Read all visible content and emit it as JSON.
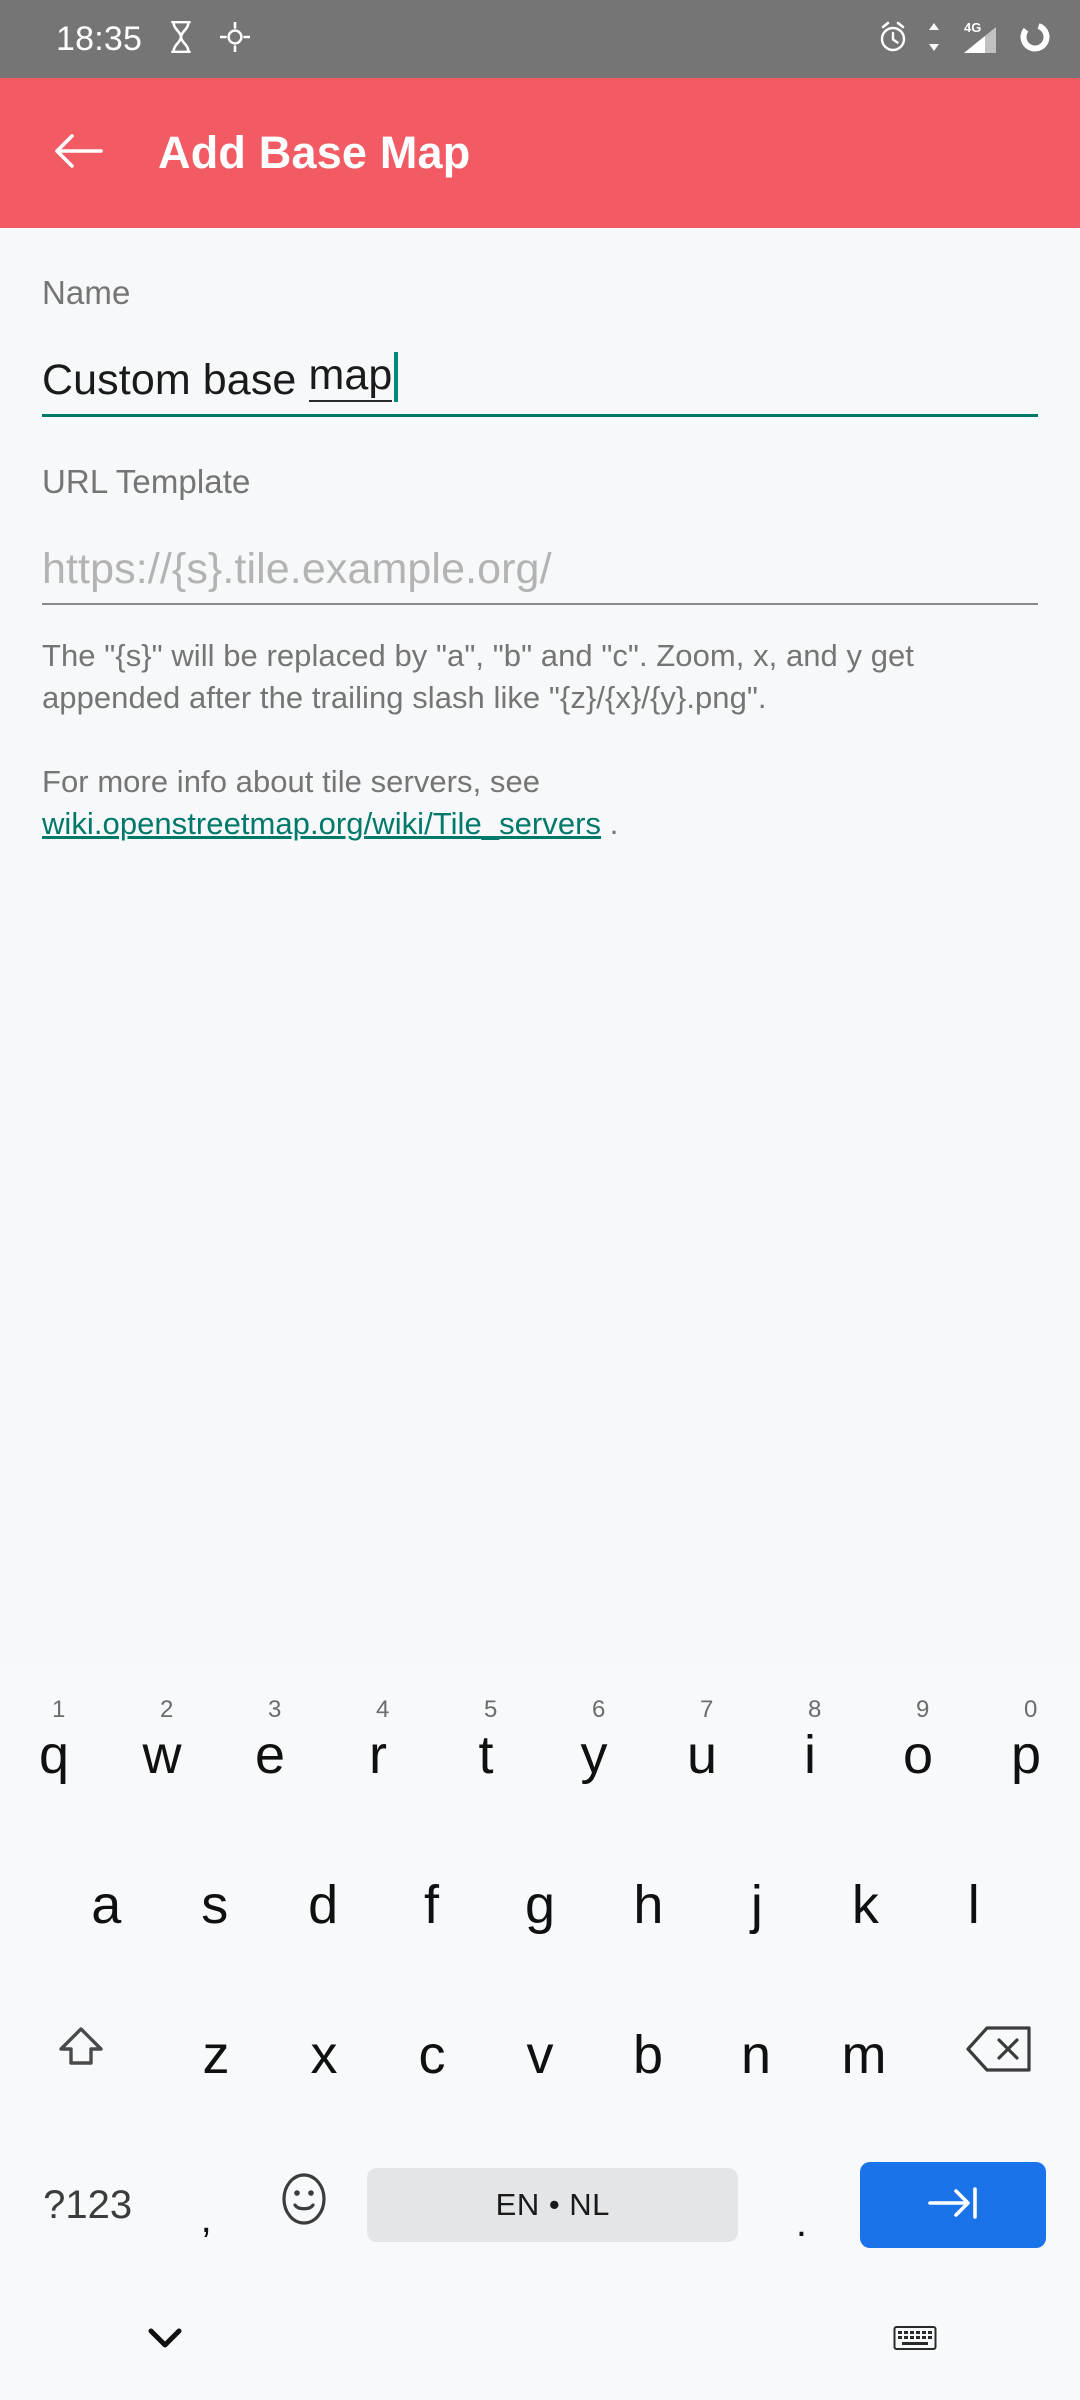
{
  "status_bar": {
    "time": "18:35",
    "network_label": "4G",
    "icons": [
      "hourglass-icon",
      "gps-crosshair-icon",
      "alarm-clock-icon",
      "data-transfer-icon",
      "signal-bars-icon",
      "battery-ring-icon"
    ]
  },
  "app_bar": {
    "title": "Add Base Map",
    "back_icon": "arrow-left-icon"
  },
  "form": {
    "name_field": {
      "label": "Name",
      "value_plain": "Custom base ",
      "value_composing": "map"
    },
    "url_field": {
      "label": "URL Template",
      "value": "",
      "placeholder": "https://{s}.tile.example.org/"
    },
    "helper_1": "The \"{s}\" will be replaced by \"a\", \"b\" and \"c\". Zoom, x, and y get appended after the trailing slash like \"{z}/{x}/{y}.png\".",
    "helper_2_prefix": "For more info about tile servers, see ",
    "helper_2_link": "wiki.openstreetmap.org/wiki/Tile_servers",
    "helper_2_suffix": " ."
  },
  "keyboard": {
    "row1": [
      {
        "key": "q",
        "hint": "1"
      },
      {
        "key": "w",
        "hint": "2"
      },
      {
        "key": "e",
        "hint": "3"
      },
      {
        "key": "r",
        "hint": "4"
      },
      {
        "key": "t",
        "hint": "5"
      },
      {
        "key": "y",
        "hint": "6"
      },
      {
        "key": "u",
        "hint": "7"
      },
      {
        "key": "i",
        "hint": "8"
      },
      {
        "key": "o",
        "hint": "9"
      },
      {
        "key": "p",
        "hint": "0"
      }
    ],
    "row2": [
      {
        "key": "a"
      },
      {
        "key": "s"
      },
      {
        "key": "d"
      },
      {
        "key": "f"
      },
      {
        "key": "g"
      },
      {
        "key": "h"
      },
      {
        "key": "j"
      },
      {
        "key": "k"
      },
      {
        "key": "l"
      }
    ],
    "row3": [
      {
        "key": "z"
      },
      {
        "key": "x"
      },
      {
        "key": "c"
      },
      {
        "key": "v"
      },
      {
        "key": "b"
      },
      {
        "key": "n"
      },
      {
        "key": "m"
      }
    ],
    "shift_icon": "shift-arrow-icon",
    "backspace_icon": "backspace-icon",
    "symbols_label": "?123",
    "comma_label": ",",
    "emoji_icon": "emoji-smiley-icon",
    "space_label": "EN • NL",
    "period_label": ".",
    "enter_icon": "enter-arrow-icon"
  },
  "nav_bar": {
    "hide_keyboard_icon": "chevron-down-icon",
    "switch_keyboard_icon": "keyboard-icon"
  },
  "colors": {
    "app_bar": "#f25b64",
    "status_bar": "#757575",
    "accent_teal": "#00796b",
    "enter_blue": "#1a73e8",
    "background": "#f7f8f9"
  }
}
